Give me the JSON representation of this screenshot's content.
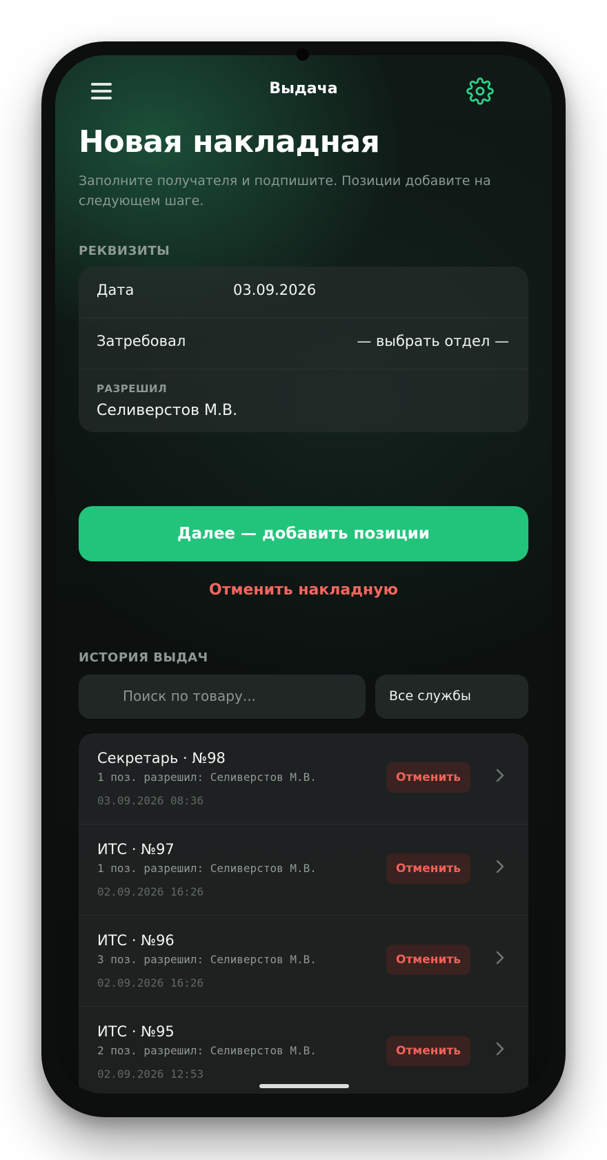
{
  "header": {
    "title": "Выдача",
    "menu_icon": "hamburger-menu-icon",
    "settings_icon": "gear-icon",
    "accent": "#22c47c"
  },
  "page": {
    "title": "Новая накладная",
    "subtitle": "Заполните получателя и подпишите. Позиции добавите на следующем шаге."
  },
  "details": {
    "section_label": "РЕКВИЗИТЫ",
    "date_label": "Дата",
    "date_value": "03.09.2026",
    "requested_label": "Затребовал",
    "requested_value": "— выбрать отдел —",
    "approved_label": "РАЗРЕШИЛ",
    "approved_value": "Селиверстов М.В."
  },
  "actions": {
    "next_label": "Далее — добавить позиции",
    "cancel_label": "Отменить накладную"
  },
  "history": {
    "section_label": "ИСТОРИЯ ВЫДАЧ",
    "search_placeholder": "Поиск по товару...",
    "filter_label": "Все службы",
    "items": [
      {
        "title": "Секретарь · №98",
        "meta": "1 поз. разрешил: Селиверстов М.В.",
        "time": "03.09.2026 08:36",
        "cancel": "Отменить"
      },
      {
        "title": "ИТС · №97",
        "meta": "1 поз. разрешил: Селиверстов М.В.",
        "time": "02.09.2026 16:26",
        "cancel": "Отменить"
      },
      {
        "title": "ИТС · №96",
        "meta": "3 поз. разрешил: Селиверстов М.В.",
        "time": "02.09.2026 16:26",
        "cancel": "Отменить"
      },
      {
        "title": "ИТС · №95",
        "meta": "2 поз. разрешил: Селиверстов М.В.",
        "time": "02.09.2026 12:53",
        "cancel": "Отменить"
      }
    ]
  },
  "colors": {
    "primary": "#22c47c",
    "danger": "#f2685f",
    "background": "#0c1210"
  }
}
